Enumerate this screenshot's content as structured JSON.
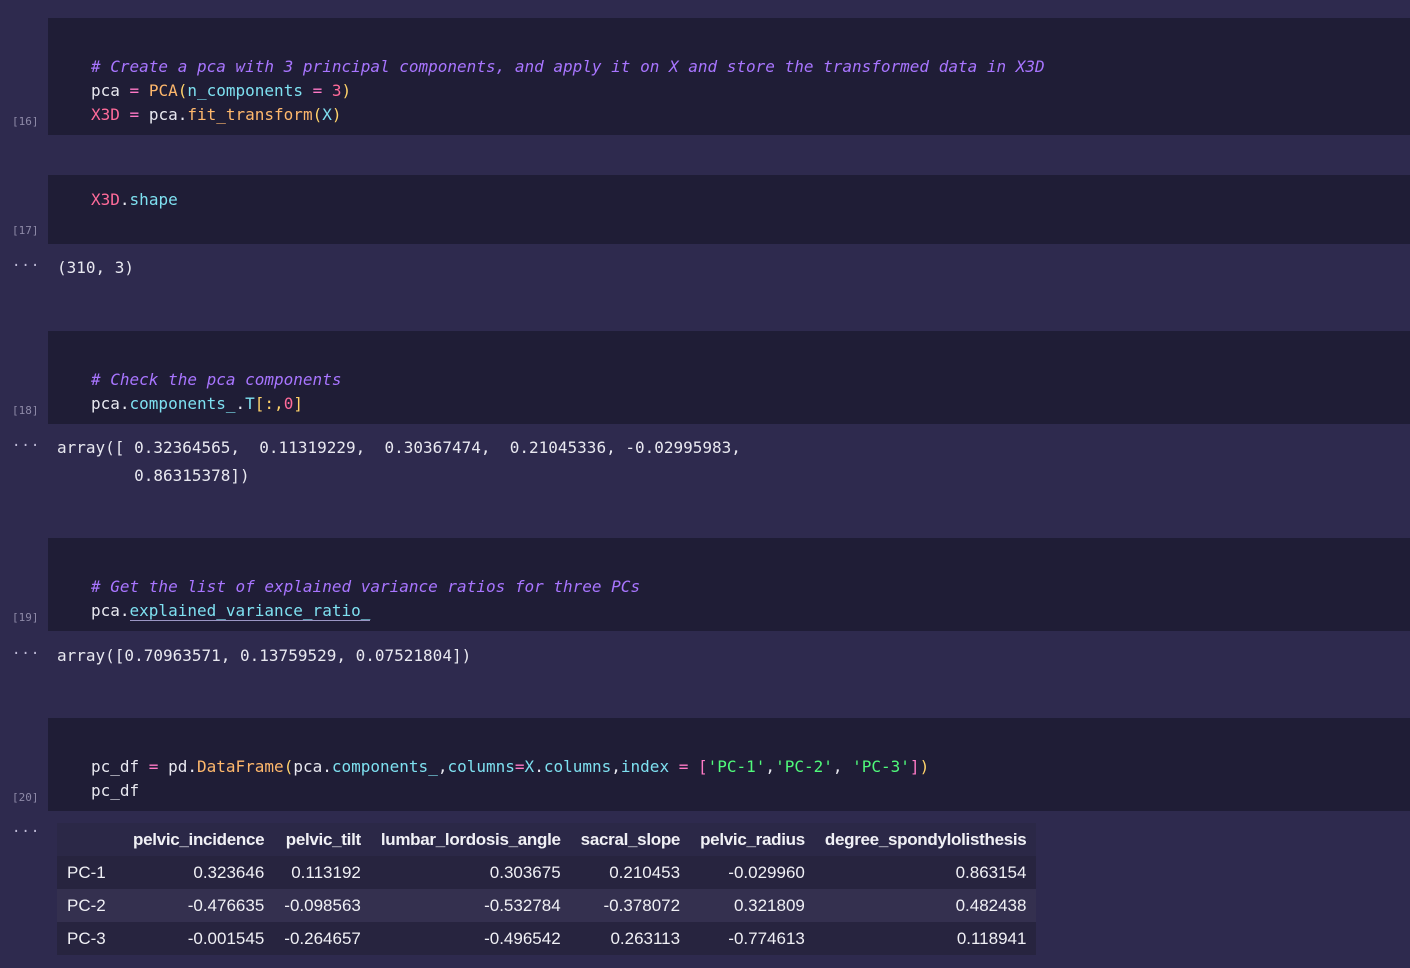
{
  "cells": [
    {
      "exec_count": "[16]",
      "code": {
        "line1_comment": "# Create a pca with 3 principal components, and apply it on X and store the transformed data in X3D",
        "line2": {
          "var": "pca",
          "op": " = ",
          "fn": "PCA",
          "paren_open": "(",
          "arg": "n_components",
          "eq": " = ",
          "num": "3",
          "paren_close": ")"
        },
        "line3": {
          "var": "X3D",
          "op": " = ",
          "obj": "pca.",
          "method": "fit_transform",
          "paren_open": "(",
          "arg": "X",
          "paren_close": ")"
        }
      }
    },
    {
      "exec_count": "[17]",
      "code": {
        "obj": "X3D",
        "dot": ".",
        "attr": "shape"
      },
      "output": "(310, 3)"
    },
    {
      "exec_count": "[18]",
      "code": {
        "line1_comment": "# Check the pca components",
        "line2": {
          "obj": "pca.",
          "attr": "components_",
          "dot": ".",
          "attr2": "T",
          "index": "[:,",
          "num": "0",
          "close": "]"
        }
      },
      "output_line1": "array([ 0.32364565,  0.11319229,  0.30367474,  0.21045336, -0.02995983,",
      "output_line2": "        0.86315378])"
    },
    {
      "exec_count": "[19]",
      "code": {
        "line1_comment": "# Get the list of explained variance ratios for three PCs",
        "line2": {
          "obj": "pca.",
          "attr": "explained_variance_ratio_"
        }
      },
      "output": "array([0.70963571, 0.13759529, 0.07521804])"
    },
    {
      "exec_count": "[20]",
      "code": {
        "line1": {
          "var": "pc_df",
          "op": " = ",
          "obj": "pd.",
          "fn": "DataFrame",
          "p1": "(",
          "obj2": "pca.",
          "attr1": "components_",
          "c1": ",",
          "kw1": "columns",
          "eq1": "=",
          "xv": "X",
          "dot": ".",
          "attr2": "columns",
          "c2": ",",
          "kw2": "index",
          "eq2": " = ",
          "lb": "[",
          "s1": "'PC-1'",
          "c3": ",",
          "s2": "'PC-2'",
          "c4": ", ",
          "s3": "'PC-3'",
          "rb": "]",
          "p2": ")"
        },
        "line2": "pc_df"
      }
    }
  ],
  "ellipsis": "···",
  "table": {
    "columns": [
      "",
      "pelvic_incidence",
      "pelvic_tilt",
      "lumbar_lordosis_angle",
      "sacral_slope",
      "pelvic_radius",
      "degree_spondylolisthesis"
    ],
    "rows": [
      [
        "PC-1",
        "0.323646",
        "0.113192",
        "0.303675",
        "0.210453",
        "-0.029960",
        "0.863154"
      ],
      [
        "PC-2",
        "-0.476635",
        "-0.098563",
        "-0.532784",
        "-0.378072",
        "0.321809",
        "0.482438"
      ],
      [
        "PC-3",
        "-0.001545",
        "-0.264657",
        "-0.496542",
        "0.263113",
        "-0.774613",
        "0.118941"
      ]
    ]
  }
}
